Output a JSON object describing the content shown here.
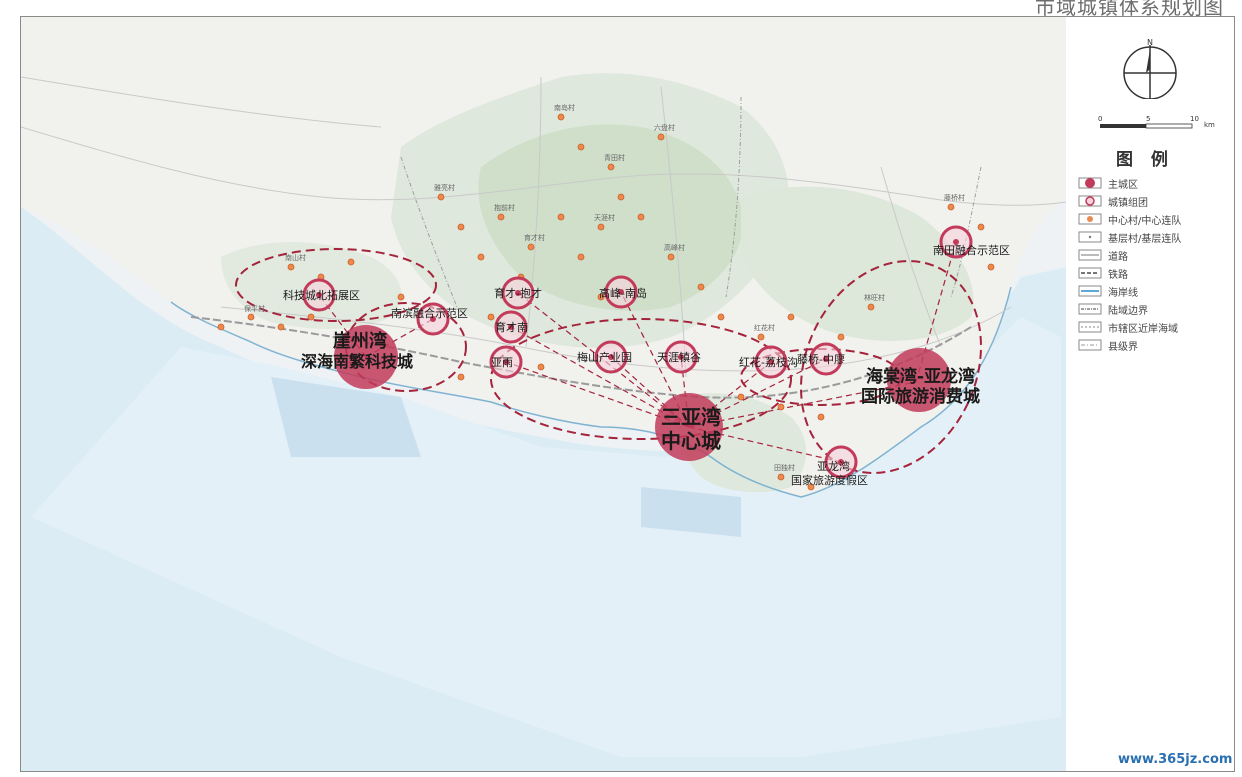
{
  "title": "市域城镇体系规划图",
  "legend": {
    "title": "图 例",
    "items": [
      {
        "label": "主城区",
        "symbol": "main-city"
      },
      {
        "label": "城镇组团",
        "symbol": "town-cluster"
      },
      {
        "label": "中心村/中心连队",
        "symbol": "center-village"
      },
      {
        "label": "基层村/基层连队",
        "symbol": "basic-village"
      },
      {
        "label": "道路",
        "symbol": "road"
      },
      {
        "label": "铁路",
        "symbol": "railway"
      },
      {
        "label": "海岸线",
        "symbol": "coastline"
      },
      {
        "label": "陆域边界",
        "symbol": "land-boundary"
      },
      {
        "label": "市辖区近岸海域",
        "symbol": "sea-boundary"
      },
      {
        "label": "县级界",
        "symbol": "county-boundary"
      }
    ],
    "scale_labels": [
      "0",
      "5",
      "10",
      "km"
    ],
    "north_label": "N"
  },
  "major_labels": {
    "yazhou": [
      "崖州湾",
      "深海南繁科技城"
    ],
    "sanya": [
      "三亚湾",
      "中心城"
    ],
    "haitang": [
      "海棠湾-亚龙湾",
      "国际旅游消费城"
    ]
  },
  "cluster_labels": {
    "yazhou_north": "科技城北拓展区",
    "nanbin": "南滨融合示范区",
    "nantian": "南田融合示范区",
    "yucai_top": "育才-抱才",
    "gaofeng": "高峰-南岛",
    "yucai": "育才南",
    "yaao": "亚雨",
    "meishan": "梅山产业园",
    "tianya": "天涯镇谷",
    "honghua": "红花-荔枝沟",
    "tenghai": "藤桥-中廖",
    "yalong": [
      "亚龙湾",
      "国家旅游度假区"
    ]
  },
  "village_labels": [
    "南山村",
    "保平村",
    "雅亮村",
    "抱前村",
    "育才村",
    "天涯村",
    "南岛村",
    "青田村",
    "高峰村",
    "红花村",
    "林旺村",
    "藤桥村",
    "六盘村",
    "田独村"
  ],
  "watermark": "www.365jz.com"
}
